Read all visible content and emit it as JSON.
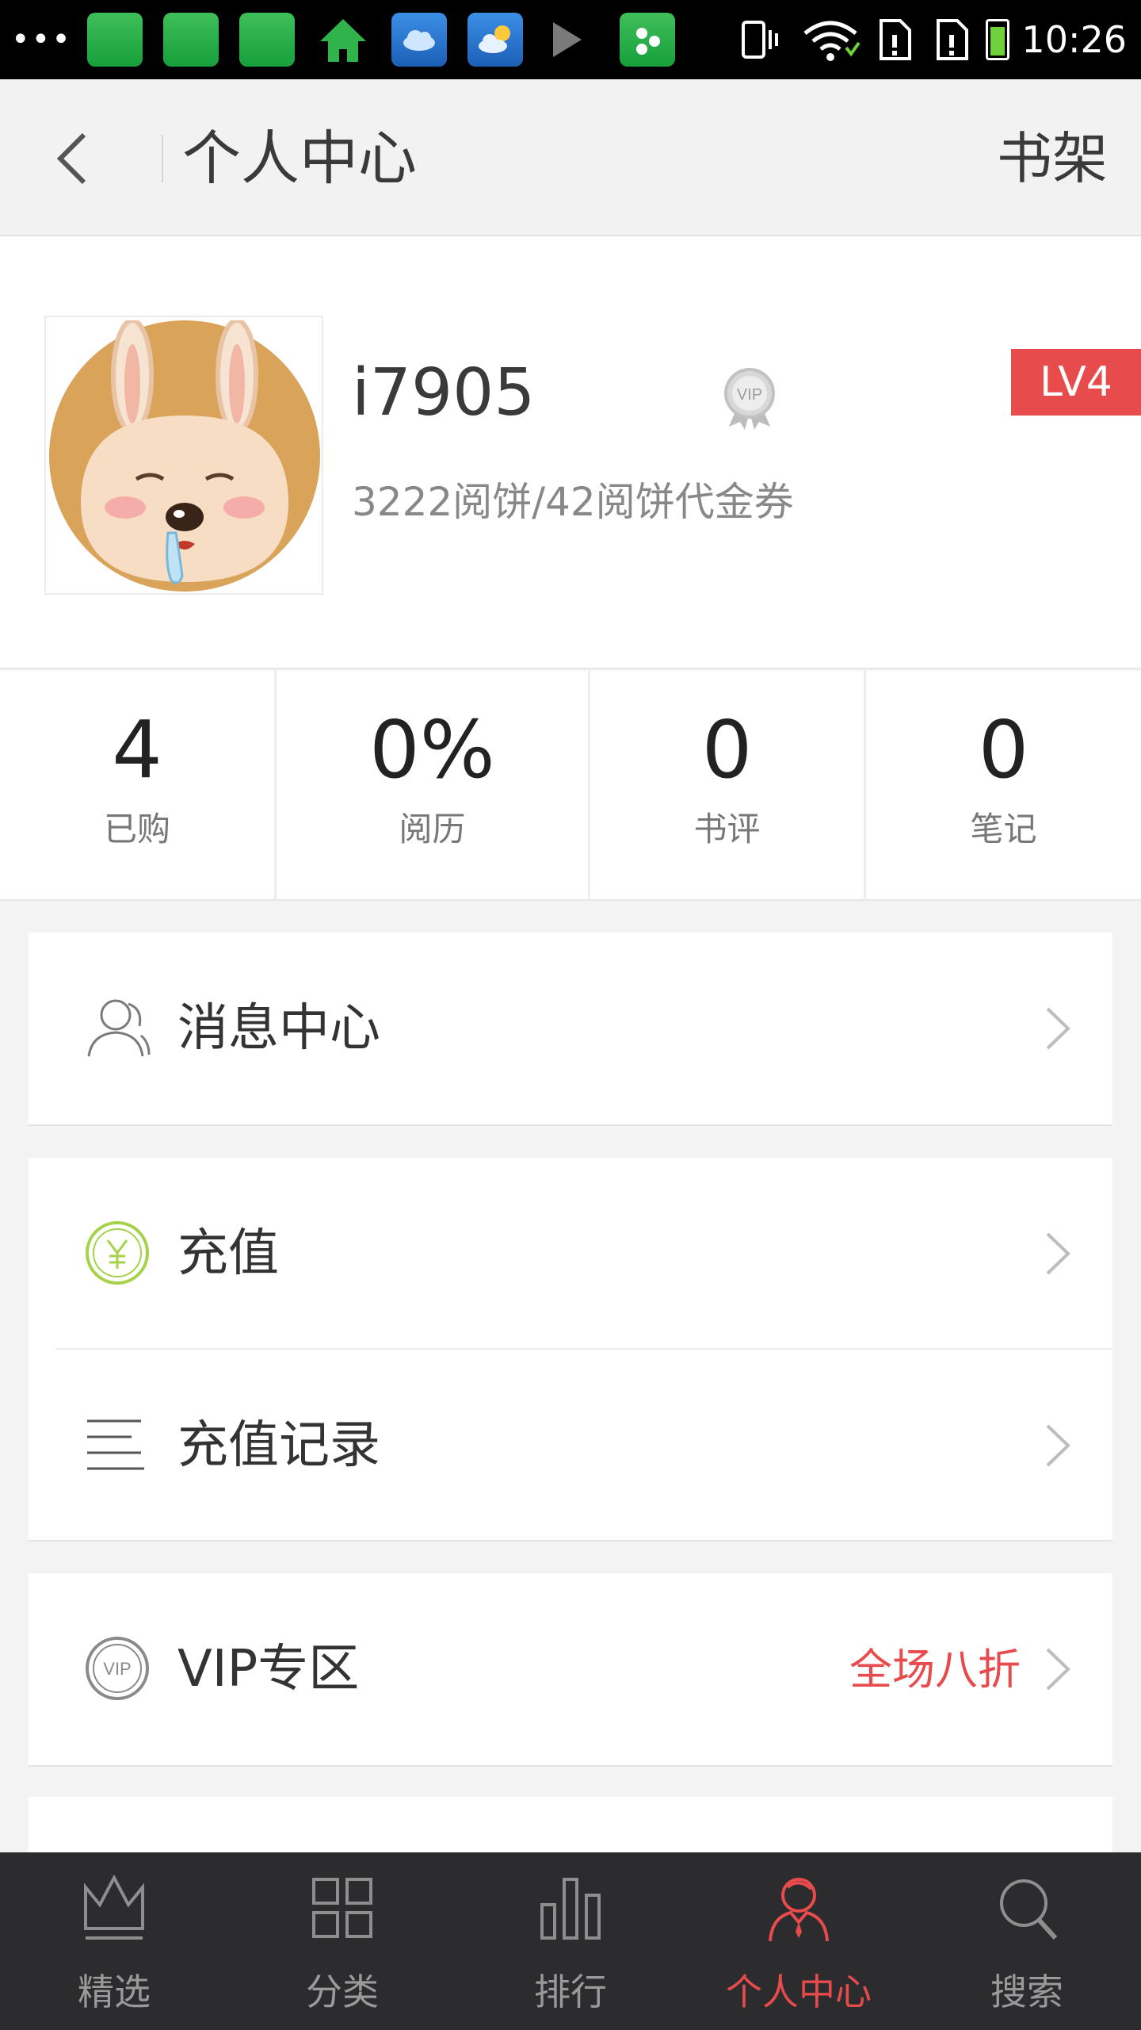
{
  "status_bar": {
    "time": "10:26"
  },
  "header": {
    "title": "个人中心",
    "bookshelf_label": "书架"
  },
  "profile": {
    "username": "i7905",
    "level": "LV4",
    "balance": "3222阅饼/42阅饼代金券"
  },
  "stats": [
    {
      "value": "4",
      "label": "已购"
    },
    {
      "value": "0%",
      "label": "阅历"
    },
    {
      "value": "0",
      "label": "书评"
    },
    {
      "value": "0",
      "label": "笔记"
    }
  ],
  "menu": {
    "messages": {
      "label": "消息中心",
      "icon": "user-icon"
    },
    "recharge": {
      "label": "充值",
      "icon": "yen-icon"
    },
    "recharge_history": {
      "label": "充值记录",
      "icon": "list-icon"
    },
    "vip": {
      "label": "VIP专区",
      "icon": "vip-icon",
      "promo": "全场八折"
    }
  },
  "bottom_nav": [
    {
      "label": "精选",
      "icon": "crown-icon"
    },
    {
      "label": "分类",
      "icon": "grid-icon"
    },
    {
      "label": "排行",
      "icon": "bar-chart-icon"
    },
    {
      "label": "个人中心",
      "icon": "person-icon",
      "active": true
    },
    {
      "label": "搜索",
      "icon": "search-icon"
    }
  ],
  "colors": {
    "accent": "#e84b4b",
    "nav_background": "#2c2c2e",
    "recharge_icon": "#a6d24a"
  }
}
